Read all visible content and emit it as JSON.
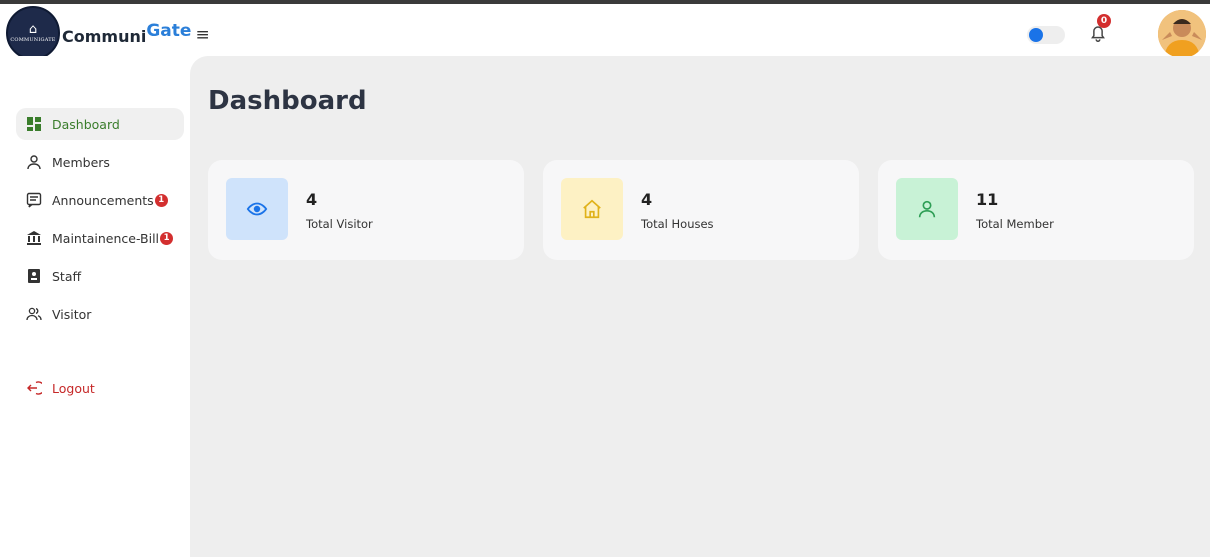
{
  "header": {
    "logo_text": "COMMUNIGATE",
    "brand_part1": "Communi",
    "brand_part2": "Gate",
    "notification_count": "0",
    "theme_toggle_on": true
  },
  "sidebar": {
    "items": [
      {
        "label": "Dashboard",
        "icon": "dashboard-icon",
        "active": true
      },
      {
        "label": "Members",
        "icon": "user-icon"
      },
      {
        "label": "Announcements",
        "icon": "announcement-icon",
        "badge": "1"
      },
      {
        "label": "Maintainence-Bill",
        "icon": "bank-icon",
        "badge": "1"
      },
      {
        "label": "Staff",
        "icon": "id-card-icon"
      },
      {
        "label": "Visitor",
        "icon": "users-icon"
      }
    ],
    "logout_label": "Logout"
  },
  "main": {
    "title": "Dashboard",
    "cards": [
      {
        "value": "4",
        "label": "Total Visitor",
        "icon": "eye-icon",
        "color": "#cfe3fb",
        "icon_color": "#1a73e8"
      },
      {
        "value": "4",
        "label": "Total Houses",
        "icon": "home-icon",
        "color": "#fdf1c4",
        "icon_color": "#e0b21a"
      },
      {
        "value": "11",
        "label": "Total Member",
        "icon": "user-icon",
        "color": "#c8f2d6",
        "icon_color": "#2e9e55"
      }
    ]
  },
  "colors": {
    "accent_green": "#3a7d2c",
    "brand_blue": "#2b7fd9",
    "badge_red": "#d32f2f",
    "logout_red": "#c62828"
  }
}
